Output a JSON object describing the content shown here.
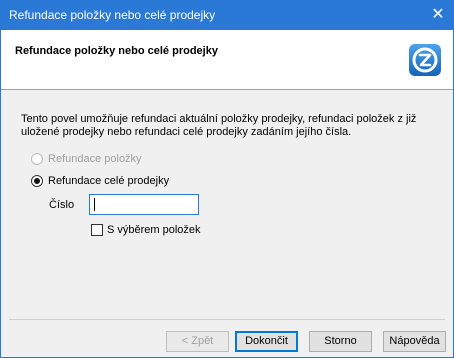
{
  "window": {
    "title": "Refundace položky nebo celé prodejky",
    "close_glyph": "✕",
    "accent_color": "#2b79d7"
  },
  "header": {
    "heading": "Refundace položky nebo celé prodejky",
    "logo_icon": "z-logo-icon"
  },
  "description": "Tento povel umožňuje refundaci aktuální položky prodejky, refundaci položek z již uložené prodejky nebo refundaci celé prodejky zadáním jejího čísla.",
  "options": {
    "refund_item": {
      "label": "Refundace položky",
      "selected": false,
      "enabled": false
    },
    "refund_whole": {
      "label": "Refundace celé prodejky",
      "selected": true,
      "enabled": true
    }
  },
  "number_field": {
    "label": "Číslo",
    "value": ""
  },
  "select_items_checkbox": {
    "label": "S výběrem položek",
    "checked": false
  },
  "buttons": {
    "back": "< Zpět",
    "finish": "Dokončit",
    "cancel": "Storno",
    "help": "Nápověda"
  }
}
